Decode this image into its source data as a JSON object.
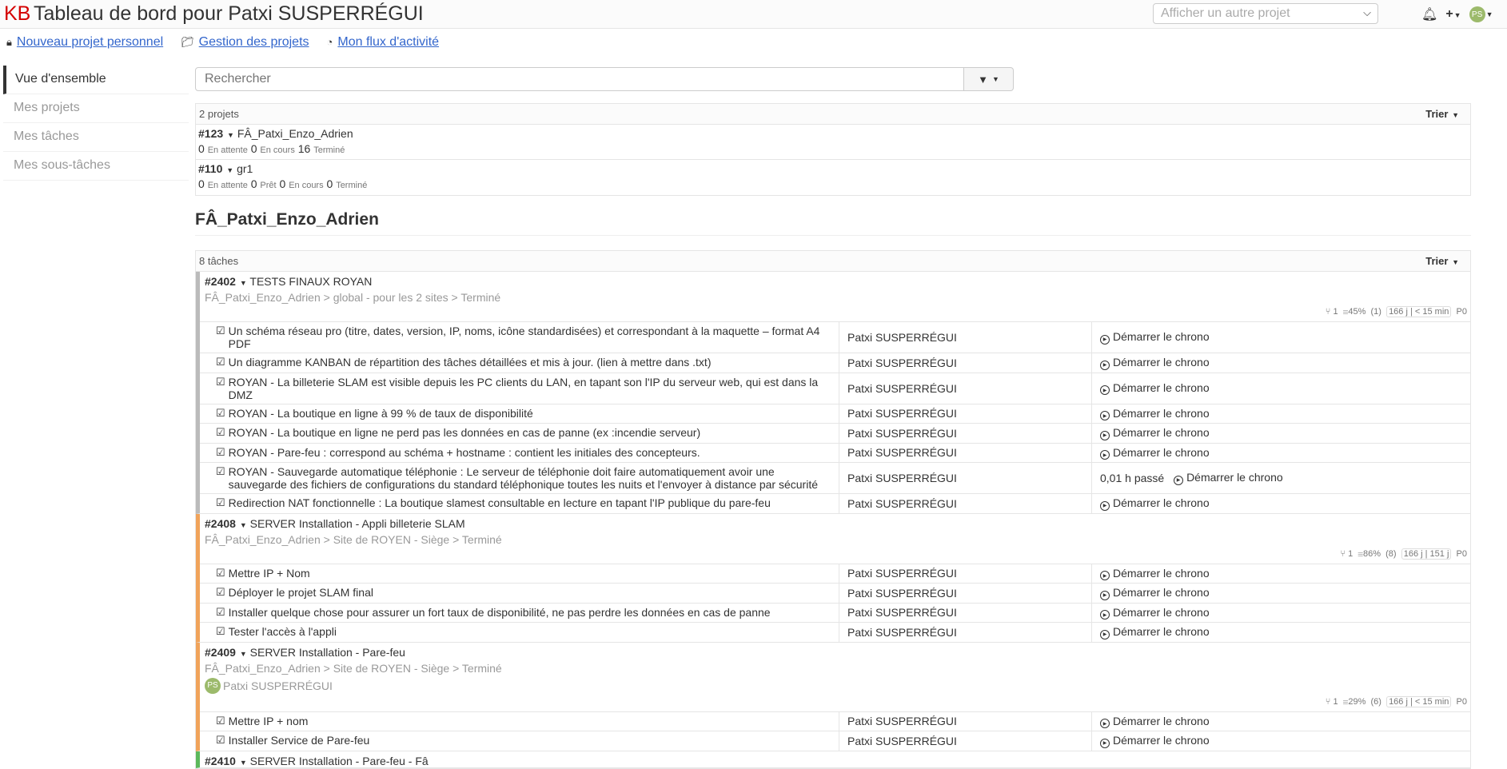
{
  "header": {
    "logo": "KB",
    "title": "Tableau de bord pour Patxi SUSPERRÉGUI",
    "project_select_placeholder": "Afficher un autre projet",
    "avatar_initials": "PS"
  },
  "toplinks": {
    "new_project": "Nouveau projet personnel",
    "manage_projects": "Gestion des projets",
    "activity": "Mon flux d'activité"
  },
  "sidebar": {
    "items": [
      {
        "label": "Vue d'ensemble"
      },
      {
        "label": "Mes projets"
      },
      {
        "label": "Mes tâches"
      },
      {
        "label": "Mes sous-tâches"
      }
    ]
  },
  "search": {
    "placeholder": "Rechercher"
  },
  "projects": {
    "count_label": "2 projets",
    "sort_label": "Trier",
    "rows": [
      {
        "id": "#123",
        "name": "FÂ_Patxi_Enzo_Adrien",
        "s1n": "0",
        "s1": "En attente",
        "s2n": "0",
        "s2": "En cours",
        "s3n": "16",
        "s3": "Terminé"
      },
      {
        "id": "#110",
        "name": "gr1",
        "s1n": "0",
        "s1": "En attente",
        "s2n": "0",
        "s2": "Prêt",
        "s3n": "0",
        "s3": "En cours",
        "s4n": "0",
        "s4": "Terminé"
      }
    ]
  },
  "section": {
    "title": "FÂ_Patxi_Enzo_Adrien",
    "tasks_count": "8 tâches",
    "sort_label": "Trier"
  },
  "tasks": [
    {
      "id": "#2402",
      "title": "TESTS FINAUX ROYAN",
      "color": "#bbbbbb",
      "crumb": "FÂ_Patxi_Enzo_Adrien > global - pour les 2 sites > Terminé",
      "meta": {
        "links": "1",
        "pct": "45%",
        "n": "(1)",
        "t1": "166 j",
        "t2": "< 15 min",
        "prio": "P0"
      },
      "subs": [
        {
          "title": "Un schéma réseau pro (titre, dates, version, IP, noms, icône standardisées) et correspondant à la maquette – format A4 PDF",
          "user": "Patxi SUSPERRÉGUI",
          "timer": "Démarrer le chrono"
        },
        {
          "title": "Un diagramme KANBAN de répartition des tâches détaillées et mis à jour. (lien à mettre dans .txt)",
          "user": "Patxi SUSPERRÉGUI",
          "timer": "Démarrer le chrono"
        },
        {
          "title": "ROYAN - La billeterie SLAM est visible depuis les PC clients du LAN, en tapant son l'IP du serveur web, qui est dans la DMZ",
          "user": "Patxi SUSPERRÉGUI",
          "timer": "Démarrer le chrono"
        },
        {
          "title": "ROYAN - La boutique en ligne à 99 % de taux de disponibilité",
          "user": "Patxi SUSPERRÉGUI",
          "timer": "Démarrer le chrono"
        },
        {
          "title": "ROYAN - La boutique en ligne ne perd pas les données en cas de panne (ex :incendie serveur)",
          "user": "Patxi SUSPERRÉGUI",
          "timer": "Démarrer le chrono"
        },
        {
          "title": "ROYAN - Pare-feu : correspond au schéma + hostname : contient les initiales des concepteurs.",
          "user": "Patxi SUSPERRÉGUI",
          "timer": "Démarrer le chrono"
        },
        {
          "title": "ROYAN - Sauvegarde automatique téléphonie : Le serveur de téléphonie doit faire automatiquement avoir une sauvegarde des fichiers de configurations du standard téléphonique toutes les nuits et l'envoyer à distance par sécurité",
          "user": "Patxi SUSPERRÉGUI",
          "spent": "0,01 h passé",
          "timer": "Démarrer le chrono"
        },
        {
          "title": "Redirection NAT fonctionnelle : La boutique slamest consultable en lecture en tapant l'IP publique du pare-feu",
          "user": "Patxi SUSPERRÉGUI",
          "timer": "Démarrer le chrono"
        }
      ]
    },
    {
      "id": "#2408",
      "title": "SERVER Installation - Appli billeterie SLAM",
      "color": "#f0a35a",
      "crumb": "FÂ_Patxi_Enzo_Adrien > Site de ROYEN - Siège > Terminé",
      "meta": {
        "links": "1",
        "pct": "86%",
        "n": "(8)",
        "t1": "166 j",
        "t2": "151 j",
        "prio": "P0"
      },
      "subs": [
        {
          "title": "Mettre IP + Nom",
          "user": "Patxi SUSPERRÉGUI",
          "timer": "Démarrer le chrono"
        },
        {
          "title": "Déployer le projet SLAM final",
          "user": "Patxi SUSPERRÉGUI",
          "timer": "Démarrer le chrono"
        },
        {
          "title": "Installer quelque chose pour assurer un fort taux de disponibilité, ne pas perdre les données en cas de panne",
          "user": "Patxi SUSPERRÉGUI",
          "timer": "Démarrer le chrono"
        },
        {
          "title": "Tester l'accès à l'appli",
          "user": "Patxi SUSPERRÉGUI",
          "timer": "Démarrer le chrono"
        }
      ]
    },
    {
      "id": "#2409",
      "title": "SERVER Installation - Pare-feu",
      "color": "#f0a35a",
      "crumb": "FÂ_Patxi_Enzo_Adrien > Site de ROYEN - Siège > Terminé",
      "assignee": "Patxi SUSPERRÉGUI",
      "assignee_initials": "PS",
      "meta": {
        "links": "1",
        "pct": "29%",
        "n": "(6)",
        "t1": "166 j",
        "t2": "< 15 min",
        "prio": "P0"
      },
      "subs": [
        {
          "title": "Mettre IP + nom",
          "user": "Patxi SUSPERRÉGUI",
          "timer": "Démarrer le chrono"
        },
        {
          "title": "Installer Service de Pare-feu",
          "user": "Patxi SUSPERRÉGUI",
          "timer": "Démarrer le chrono"
        }
      ]
    },
    {
      "id": "#2410",
      "title": "SERVER Installation - Pare-feu - Fâ",
      "color": "#5cb85c",
      "subs": []
    }
  ]
}
